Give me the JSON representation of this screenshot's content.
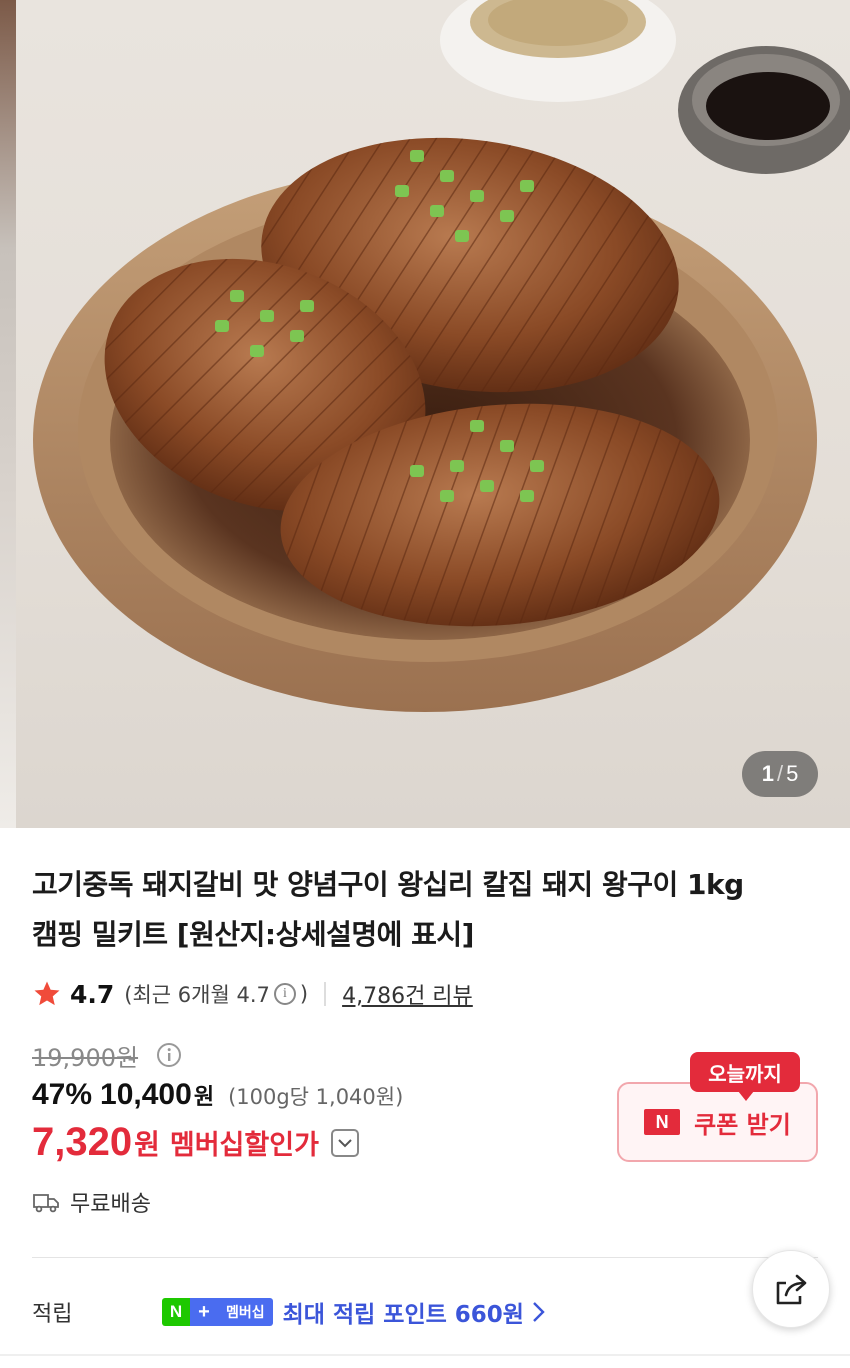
{
  "gallery": {
    "image_alt": "marinated pork ribs in a ceramic bowl",
    "current": "1",
    "separator": "/",
    "total": "5"
  },
  "product": {
    "title_line1": "고기중독 돼지갈비 맛 양념구이 왕십리 칼집 돼지 왕구이 1kg",
    "title_line2": "캠핑 밀키트 [원산지:상세설명에 표시]"
  },
  "rating": {
    "score": "4.7",
    "recent_prefix": "(최근 6개월 4.7",
    "recent_suffix": ")",
    "info_icon": "i",
    "review_count": "4,786건 리뷰"
  },
  "price": {
    "original": "19,900원",
    "discount": "47%",
    "sale": "10,400",
    "sale_unit": "원",
    "unit_price": "(100g당 1,040원)",
    "member": "7,320",
    "member_unit": "원",
    "member_label": "멤버십할인가"
  },
  "coupon": {
    "badge": "오늘까지",
    "n_mark": "N",
    "label": "쿠폰 받기"
  },
  "shipping": {
    "label": "무료배송"
  },
  "points": {
    "label": "적립",
    "badge_n": "N",
    "badge_plus": "+",
    "badge_text": "멤버십",
    "text": "최대 적립 포인트",
    "amount": "660원"
  },
  "colors": {
    "accent_red": "#e32b3b",
    "accent_blue": "#3b55d9",
    "naver_green": "#1ec800"
  }
}
